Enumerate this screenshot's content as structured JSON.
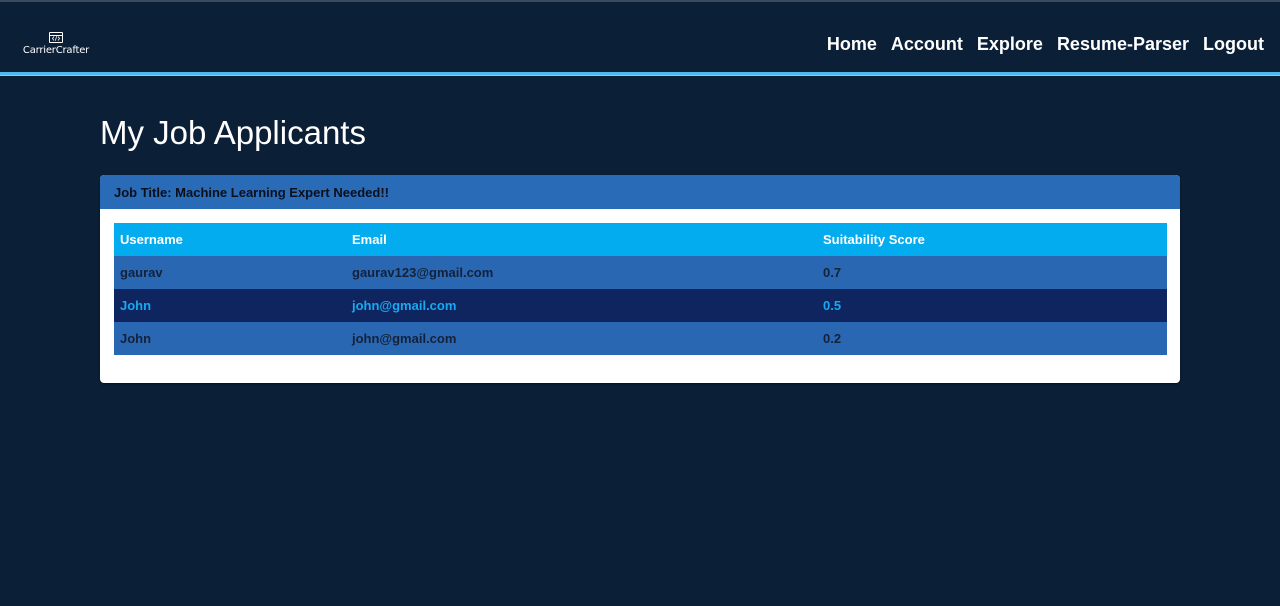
{
  "brand": {
    "name": "CarrierCrafter",
    "icon": "code-window-icon"
  },
  "nav": {
    "links": [
      "Home",
      "Account",
      "Explore",
      "Resume-Parser",
      "Logout"
    ]
  },
  "page": {
    "title": "My Job Applicants"
  },
  "job": {
    "header": "Job Title: Machine Learning Expert Needed!!"
  },
  "table": {
    "columns": [
      "Username",
      "Email",
      "Suitability Score"
    ],
    "rows": [
      {
        "username": "gaurav",
        "email": "gaurav123@gmail.com",
        "score": "0.7"
      },
      {
        "username": "John",
        "email": "john@gmail.com",
        "score": "0.5"
      },
      {
        "username": "John",
        "email": "john@gmail.com",
        "score": "0.2"
      }
    ]
  },
  "colors": {
    "background": "#0b1f37",
    "nav_underline": "#4fb7f0",
    "card_header": "#2a6bb8",
    "table_header": "#03acef",
    "row_default": "#2a67b2",
    "row_highlight": "#0e2560",
    "highlight_text": "#18a9f0"
  }
}
